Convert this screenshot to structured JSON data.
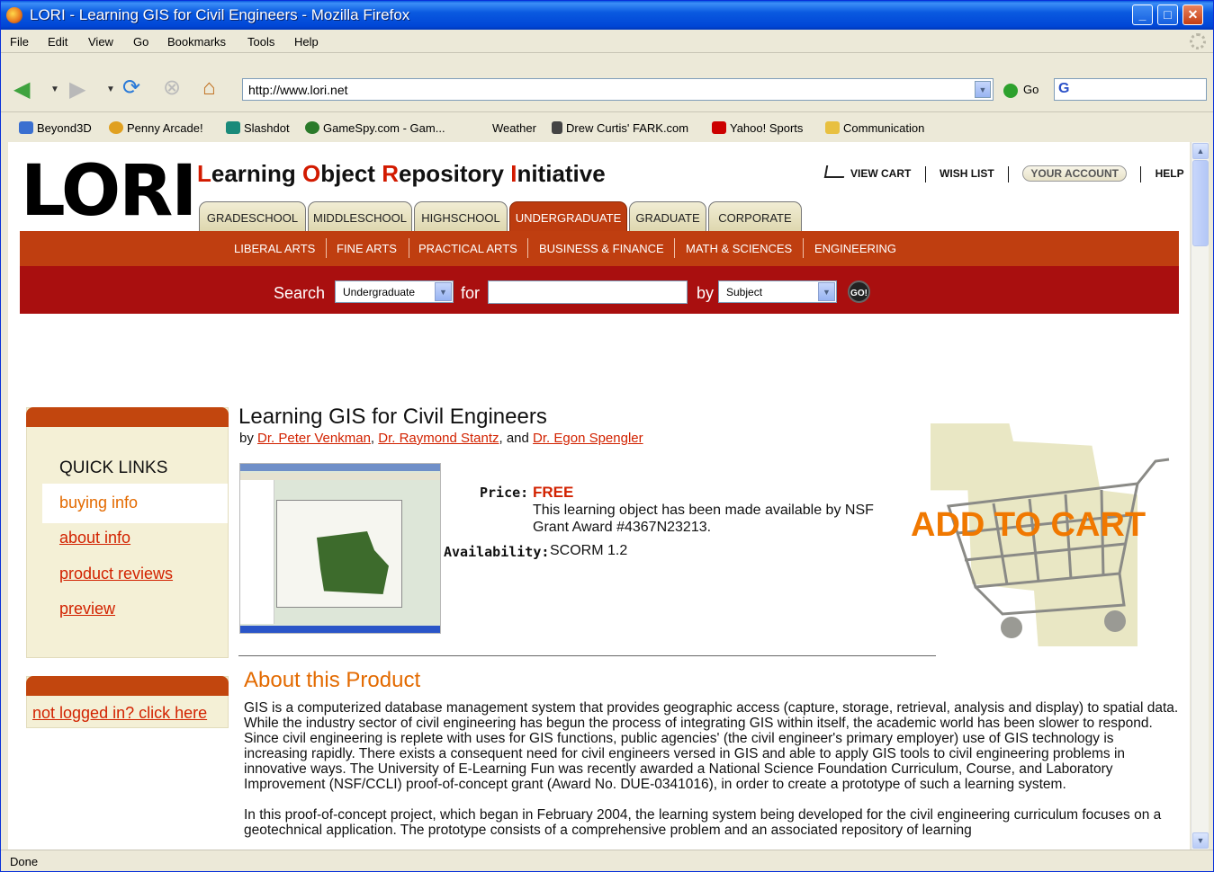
{
  "window": {
    "title": "LORI - Learning GIS for Civil Engineers - Mozilla Firefox"
  },
  "menu": [
    "File",
    "Edit",
    "View",
    "Go",
    "Bookmarks",
    "Tools",
    "Help"
  ],
  "nav": {
    "url": "http://www.lori.net",
    "go_label": "Go",
    "search_engine": "G"
  },
  "bookmarks": [
    {
      "label": "Beyond3D",
      "color": "#3a6fd0"
    },
    {
      "label": "Penny Arcade!",
      "color": "#e0a020"
    },
    {
      "label": "Slashdot",
      "color": "#1a8a7a"
    },
    {
      "label": "GameSpy.com - Gam...",
      "color": "#2a7a2a"
    },
    {
      "label": "Weather",
      "color": ""
    },
    {
      "label": "Drew Curtis' FARK.com",
      "color": "#444"
    },
    {
      "label": "Yahoo! Sports",
      "color": "#c00"
    },
    {
      "label": "Communication",
      "color": "#e8c040"
    }
  ],
  "site": {
    "logo": "LORI",
    "tagline": [
      "L",
      "earning ",
      "O",
      "bject ",
      "R",
      "epository ",
      "I",
      "nitiative"
    ],
    "top_links": {
      "cart": "VIEW CART",
      "wishlist": "WISH LIST",
      "account": "YOUR ACCOUNT",
      "help": "HELP"
    },
    "tabs": [
      "GRADESCHOOL",
      "MIDDLESCHOOL",
      "HIGHSCHOOL",
      "UNDERGRADUATE",
      "GRADUATE",
      "CORPORATE"
    ],
    "active_tab": "UNDERGRADUATE",
    "subnav": [
      "LIBERAL ARTS",
      "FINE ARTS",
      "PRACTICAL ARTS",
      "BUSINESS & FINANCE",
      "MATH & SCIENCES",
      "ENGINEERING"
    ],
    "search": {
      "label": "Search",
      "level": "Undergraduate",
      "for_label": "for",
      "query": "",
      "by_label": "by",
      "field": "Subject",
      "go": "GO!"
    }
  },
  "quick_links": {
    "heading": "QUICK LINKS",
    "items": [
      "buying info",
      "about info",
      "product reviews",
      "preview"
    ],
    "active": "buying info"
  },
  "login_link": "not logged in? click here",
  "product": {
    "title": "Learning GIS for Civil Engineers",
    "by": "by",
    "authors": [
      "Dr. Peter Venkman",
      "Dr. Raymond Stantz",
      "Dr. Egon Spengler"
    ],
    "and": ", and",
    "price_label": "Price:",
    "price": "FREE",
    "price_note": "This learning object has been made available by NSF Grant Award #4367N23213.",
    "availability_label": "Availability:",
    "availability": "SCORM 1.2",
    "add_to_cart": "ADD TO CART"
  },
  "about": {
    "heading": "About this Product",
    "p1": "GIS is a computerized database management system that provides geographic access (capture, storage, retrieval, analysis and display) to spatial data. While the industry sector of civil engineering has begun the process of integrating GIS within itself, the academic world has been slower to respond. Since civil engineering is replete with uses for GIS functions, public agencies' (the civil engineer's primary employer) use of GIS technology is increasing rapidly. There exists a consequent need for civil engineers versed in GIS and able to apply GIS tools to civil engineering problems in innovative ways. The University of E-Learning Fun was recently awarded a National Science Foundation Curriculum, Course, and Laboratory Improvement (NSF/CCLI) proof-of-concept grant (Award No. DUE-0341016), in order to create a prototype of such a learning system.",
    "p2": "In this proof-of-concept project, which began in February 2004, the learning system being developed for the civil engineering curriculum focuses on a geotechnical application. The prototype consists of a comprehensive problem and an associated repository of learning"
  },
  "status": "Done"
}
